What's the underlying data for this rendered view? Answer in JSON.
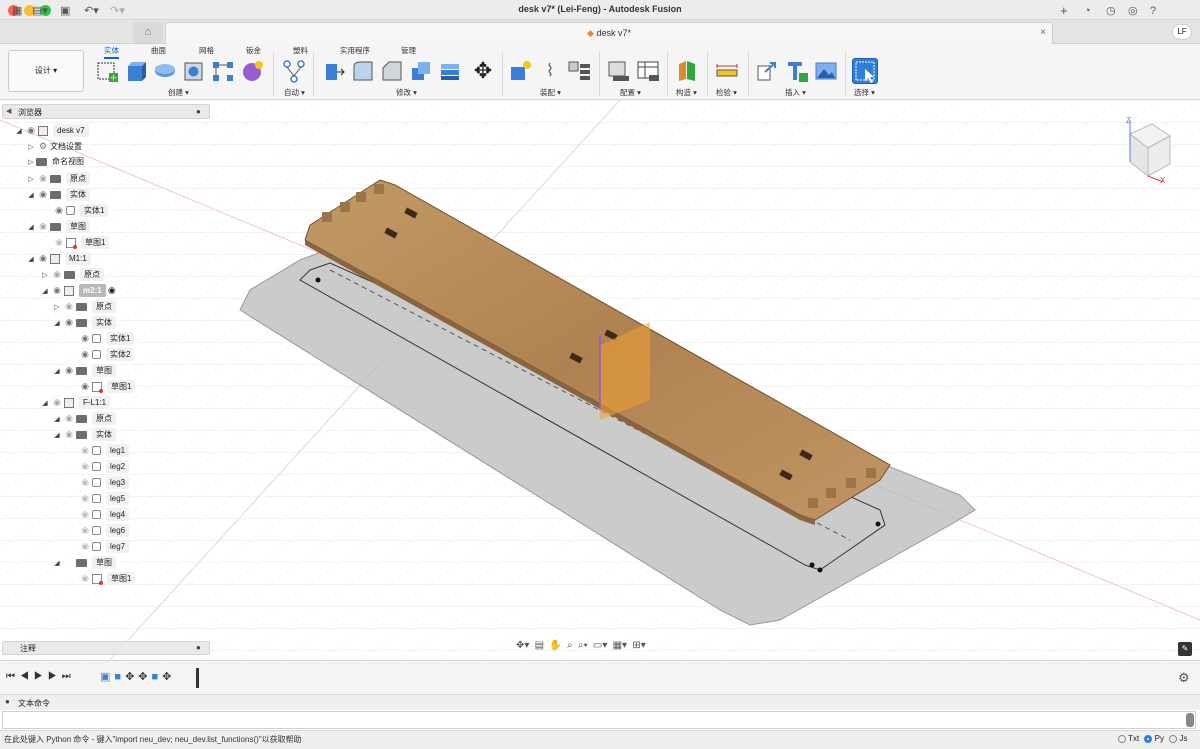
{
  "window": {
    "title": "desk v7* (Lei-Feng) - Autodesk Fusion"
  },
  "tab": {
    "label": "desk v7*",
    "user_initials": "LF"
  },
  "ribbon": {
    "workspace": "设计 ▾",
    "tabs": [
      "实体",
      "曲面",
      "网格",
      "钣金",
      "塑料",
      "实用程序",
      "管理"
    ],
    "groups": [
      "创建 ▾",
      "自动 ▾",
      "修改 ▾",
      "装配 ▾",
      "配置 ▾",
      "构造 ▾",
      "检验 ▾",
      "插入 ▾",
      "选择 ▾"
    ]
  },
  "browser": {
    "title": "浏览器",
    "items": [
      {
        "label": "desk v7"
      },
      {
        "label": "文档设置"
      },
      {
        "label": "命名视图"
      },
      {
        "label": "原点"
      },
      {
        "label": "实体"
      },
      {
        "label": "实体1"
      },
      {
        "label": "草图"
      },
      {
        "label": "草图1"
      },
      {
        "label": "M1:1"
      },
      {
        "label": "原点"
      },
      {
        "label": "m2:1"
      },
      {
        "label": "原点"
      },
      {
        "label": "实体"
      },
      {
        "label": "实体1"
      },
      {
        "label": "实体2"
      },
      {
        "label": "草图"
      },
      {
        "label": "草图1"
      },
      {
        "label": "F-L1:1"
      },
      {
        "label": "原点"
      },
      {
        "label": "实体"
      },
      {
        "label": "leg1"
      },
      {
        "label": "leg2"
      },
      {
        "label": "leg3"
      },
      {
        "label": "leg5"
      },
      {
        "label": "leg4"
      },
      {
        "label": "leg6"
      },
      {
        "label": "leg7"
      },
      {
        "label": "草图"
      },
      {
        "label": "草图1"
      }
    ]
  },
  "notes": {
    "title": "注释"
  },
  "viewcube": {
    "axis_z": "Z",
    "axis_x": "X"
  },
  "text_commands": {
    "title": "文本命令",
    "status_hint": "在此处键入 Python 命令 - 键入\"import neu_dev; neu_dev.list_functions()\"以获取帮助",
    "modes": [
      "Txt",
      "Py",
      "Js"
    ],
    "selected_mode": "Py"
  },
  "colors": {
    "accent": "#0a66c2",
    "wood": "#b38a56",
    "highlight": "#f0a030"
  }
}
